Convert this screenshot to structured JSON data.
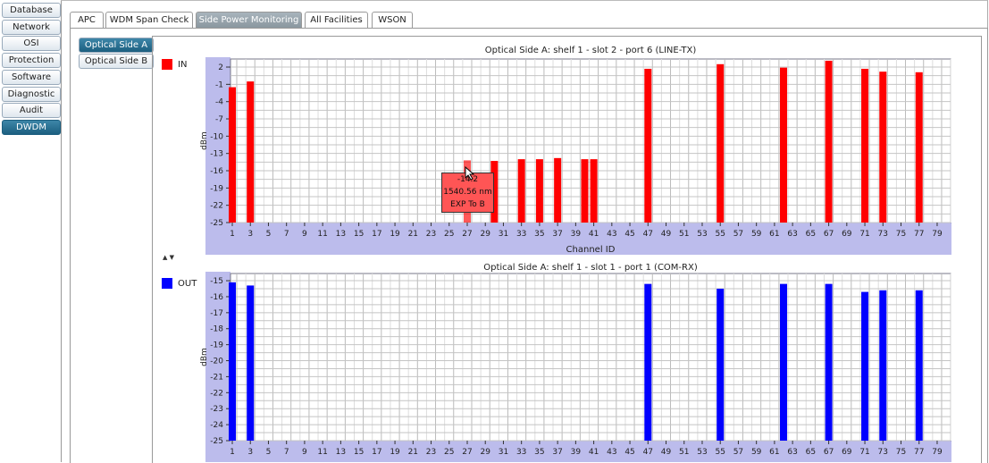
{
  "sidebar": {
    "items": [
      {
        "label": "Database"
      },
      {
        "label": "Network"
      },
      {
        "label": "OSI"
      },
      {
        "label": "Protection"
      },
      {
        "label": "Software"
      },
      {
        "label": "Diagnostic"
      },
      {
        "label": "Audit"
      },
      {
        "label": "DWDM",
        "active": true
      }
    ]
  },
  "tabs": [
    {
      "label": "APC"
    },
    {
      "label": "WDM Span Check"
    },
    {
      "label": "Side Power Monitoring",
      "active": true
    },
    {
      "label": "All Facilities"
    },
    {
      "label": "WSON"
    }
  ],
  "subtabs": [
    {
      "label": "Optical Side A",
      "active": true
    },
    {
      "label": "Optical Side B"
    }
  ],
  "splitter_label": "▲ ▼",
  "tooltip": {
    "value": "-14.2",
    "wavelength": "1540.56 nm",
    "direction": "EXP To B"
  },
  "colors": {
    "in": "#ff0000",
    "out": "#0000ff",
    "axis_band": "#bcbcec"
  },
  "chart_data": [
    {
      "type": "bar",
      "title": "Optical Side A: shelf 1 - slot 2 - port 6 (LINE-TX)",
      "legend": "IN",
      "xlabel": "Channel ID",
      "ylabel": "dBm",
      "ylim": [
        -25,
        3.4
      ],
      "yticks": [
        2,
        -1,
        -4,
        -7,
        -10,
        -13,
        -16,
        -19,
        -22,
        -25
      ],
      "x": [
        1,
        3,
        27,
        30,
        33,
        35,
        37,
        40,
        41,
        47,
        55,
        62,
        67,
        71,
        73,
        77
      ],
      "values": [
        -1.5,
        -0.5,
        -14.2,
        -14.3,
        -14,
        -14,
        -13.8,
        -14,
        -14,
        1.7,
        2.5,
        1.9,
        3.1,
        1.7,
        1.2,
        1.1
      ],
      "highlight": 27
    },
    {
      "type": "bar",
      "title": "Optical Side A: shelf 1 - slot 1 - port 1 (COM-RX)",
      "legend": "OUT",
      "xlabel": "Channel ID",
      "ylabel": "dBm",
      "ylim": [
        -25,
        -14.55
      ],
      "yticks": [
        -15,
        -16,
        -17,
        -18,
        -19,
        -20,
        -21,
        -22,
        -23,
        -24,
        -25
      ],
      "x": [
        1,
        3,
        47,
        55,
        62,
        67,
        71,
        73,
        77
      ],
      "values": [
        -15.1,
        -15.3,
        -15.2,
        -15.5,
        -15.2,
        -15.2,
        -15.7,
        -15.6,
        -15.6
      ]
    }
  ]
}
